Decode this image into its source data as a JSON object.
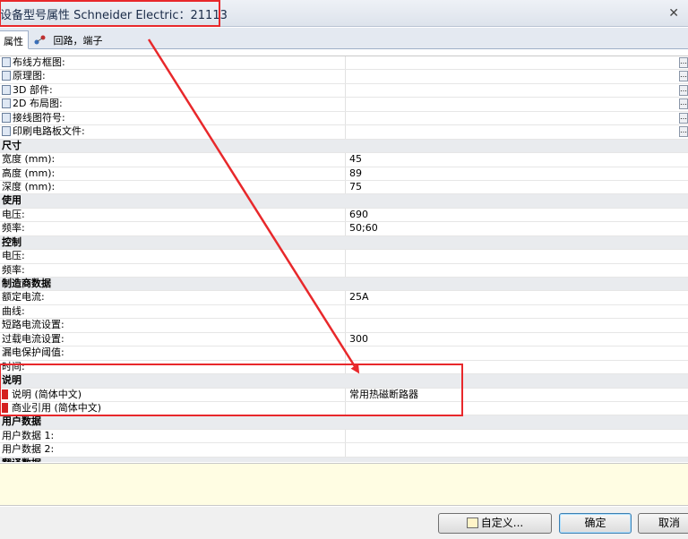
{
  "window": {
    "title": "设备型号属性 Schneider Electric：21113"
  },
  "tabs": [
    {
      "label": "属性"
    },
    {
      "label": "回路，端子"
    }
  ],
  "icons": {
    "close": "close-icon",
    "attributes_tab": "attributes-tab-icon",
    "circuit_tab": "circuit-icon"
  },
  "grid": {
    "rows": [
      {
        "kind": "prop",
        "label": "布线方框图:",
        "value": "",
        "icon": "block-diagram-icon",
        "more": true
      },
      {
        "kind": "prop",
        "label": "原理图:",
        "value": "",
        "icon": "schematic-icon",
        "more": true
      },
      {
        "kind": "prop",
        "label": "3D 部件:",
        "value": "",
        "icon": "3d-part-icon",
        "more": true
      },
      {
        "kind": "prop",
        "label": "2D 布局图:",
        "value": "",
        "icon": "2d-layout-icon",
        "more": true
      },
      {
        "kind": "prop",
        "label": "接线图符号:",
        "value": "",
        "icon": "wiring-symbol-icon",
        "more": true
      },
      {
        "kind": "prop",
        "label": "印刷电路板文件:",
        "value": "",
        "icon": "pcb-file-icon",
        "more": true
      },
      {
        "kind": "cat",
        "label": "尺寸"
      },
      {
        "kind": "prop",
        "label": "宽度 (mm):",
        "value": "45"
      },
      {
        "kind": "prop",
        "label": "高度 (mm):",
        "value": "89"
      },
      {
        "kind": "prop",
        "label": "深度 (mm):",
        "value": "75"
      },
      {
        "kind": "cat",
        "label": "使用"
      },
      {
        "kind": "prop",
        "label": "电压:",
        "value": "690"
      },
      {
        "kind": "prop",
        "label": "频率:",
        "value": "50;60"
      },
      {
        "kind": "cat",
        "label": "控制"
      },
      {
        "kind": "prop",
        "label": "电压:",
        "value": ""
      },
      {
        "kind": "prop",
        "label": "频率:",
        "value": ""
      },
      {
        "kind": "cat",
        "label": "制造商数据"
      },
      {
        "kind": "prop",
        "label": "额定电流:",
        "value": "25A"
      },
      {
        "kind": "prop",
        "label": "曲线:",
        "value": ""
      },
      {
        "kind": "prop",
        "label": "短路电流设置:",
        "value": ""
      },
      {
        "kind": "prop",
        "label": "过载电流设置:",
        "value": "300"
      },
      {
        "kind": "prop",
        "label": "漏电保护阈值:",
        "value": ""
      },
      {
        "kind": "prop",
        "label": "时间:",
        "value": ""
      },
      {
        "kind": "cat",
        "label": "说明"
      },
      {
        "kind": "prop",
        "label": "说明 (简体中文)",
        "value": "常用热磁断路器",
        "icon": "language-flag-icon",
        "red": true
      },
      {
        "kind": "prop",
        "label": "商业引用 (简体中文)",
        "value": "",
        "icon": "language-flag-icon",
        "red": true
      },
      {
        "kind": "cat",
        "label": "用户数据"
      },
      {
        "kind": "prop",
        "label": "用户数据 1:",
        "value": ""
      },
      {
        "kind": "prop",
        "label": "用户数据 2:",
        "value": ""
      },
      {
        "kind": "cat",
        "label": "翻译数据"
      }
    ]
  },
  "buttons": {
    "custom": "自定义...",
    "ok": "确定",
    "cancel": "取消"
  },
  "colors": {
    "annotation": "#e8282b",
    "description_bg": "#fffde3"
  }
}
